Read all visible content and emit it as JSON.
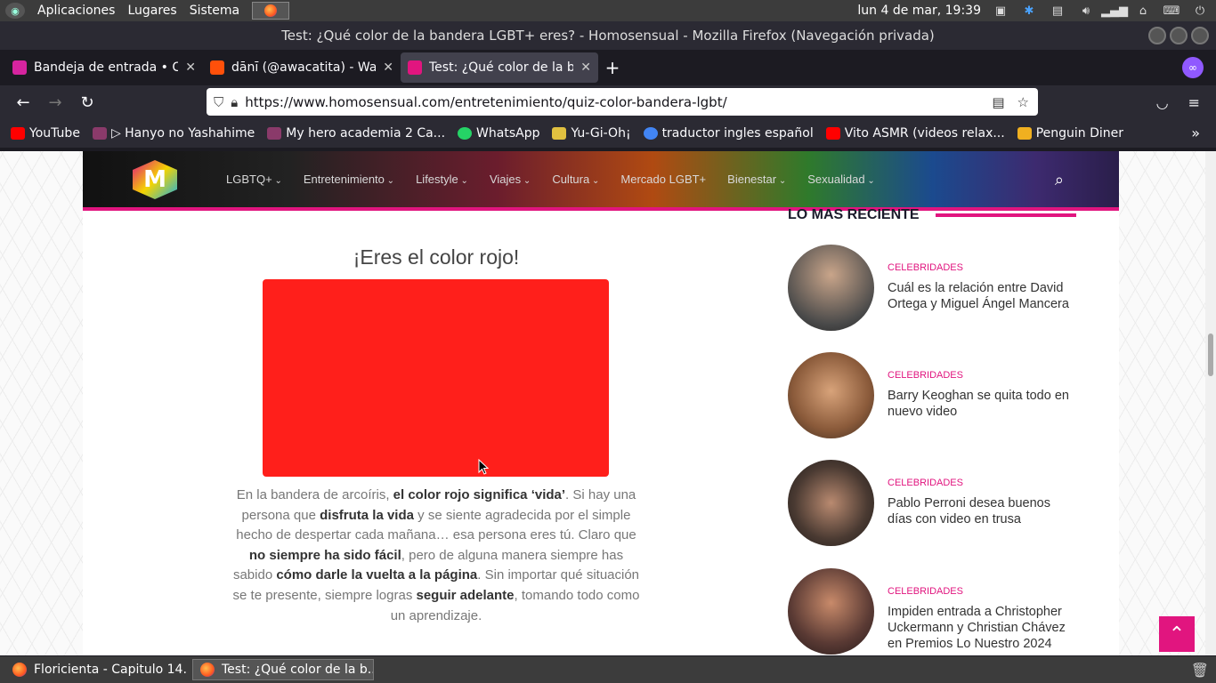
{
  "system_panel": {
    "menus": [
      "Aplicaciones",
      "Lugares",
      "Sistema"
    ],
    "clock": "lun  4 de mar, 19:39"
  },
  "window": {
    "title": "Test: ¿Qué color de la bandera LGBT+ eres? - Homosensual - Mozilla Firefox (Navegación privada)"
  },
  "tabs": [
    {
      "label": "Bandeja de entrada • Chat",
      "favicon_color": "#d6249f"
    },
    {
      "label": "dānī (@awacatita) - Wattpad",
      "favicon_color": "#ff500a"
    },
    {
      "label": "Test: ¿Qué color de la bandera",
      "favicon_color": "#2a1e4a"
    }
  ],
  "urlbar": {
    "url": "https://www.homosensual.com/entretenimiento/quiz-color-bandera-lgbt/"
  },
  "bookmarks": [
    {
      "label": "YouTube",
      "icon": "youtube-icon",
      "color": "#ff0000"
    },
    {
      "label": "▷ Hanyo no Yashahime",
      "icon": "anime-icon",
      "color": "#8a3a6a"
    },
    {
      "label": "My hero academia 2 Ca...",
      "icon": "anime-icon",
      "color": "#8a3a6a"
    },
    {
      "label": "WhatsApp",
      "icon": "whatsapp-icon",
      "color": "#25d366"
    },
    {
      "label": "Yu-Gi-Oh¡",
      "icon": "yugioh-icon",
      "color": "#e0c040"
    },
    {
      "label": "traductor ingles español",
      "icon": "google-icon",
      "color": "#4285f4"
    },
    {
      "label": "Vito ASMR (videos relax...",
      "icon": "youtube-icon",
      "color": "#ff0000"
    },
    {
      "label": "Penguin Diner",
      "icon": "game-icon",
      "color": "#f0b020"
    }
  ],
  "site": {
    "nav_items": [
      "LGBTQ+",
      "Entretenimiento",
      "Lifestyle",
      "Viajes",
      "Cultura",
      "Mercado LGBT+",
      "Bienestar",
      "Sexualidad"
    ],
    "result_title": "¡Eres el color rojo!",
    "result_color": "#ff1f1b",
    "desc": {
      "p1": "En la bandera de arcoíris, ",
      "b1": "el color rojo significa ‘vida’",
      "p2": ". Si hay una persona que ",
      "b2": "disfruta la vida",
      "p3": " y se siente agradecida por el simple hecho de despertar cada mañana… esa persona eres tú. Claro que ",
      "b3": "no siempre ha sido fácil",
      "p4": ", pero de alguna manera siempre has sabido ",
      "b4": "cómo darle la vuelta a la página",
      "p5": ". Sin importar qué situación se te presente, siempre logras ",
      "b5": "seguir adelante",
      "p6": ", tomando todo como un aprendizaje."
    },
    "recent_heading": "LO MAS RECIENTE",
    "posts": [
      {
        "category": "CELEBRIDADES",
        "title": "Cuál es la relación entre David Ortega y Miguel Ángel Mancera"
      },
      {
        "category": "CELEBRIDADES",
        "title": "Barry Keoghan se quita todo en nuevo video"
      },
      {
        "category": "CELEBRIDADES",
        "title": "Pablo Perroni desea buenos días con video en trusa"
      },
      {
        "category": "CELEBRIDADES",
        "title": "Impiden entrada a Christopher Uckermann y Christian Chávez en Premios Lo Nuestro 2024"
      }
    ]
  },
  "taskbar": [
    {
      "label": "Floricienta - Capitulo 14..."
    },
    {
      "label": "Test: ¿Qué color de la b..."
    }
  ]
}
